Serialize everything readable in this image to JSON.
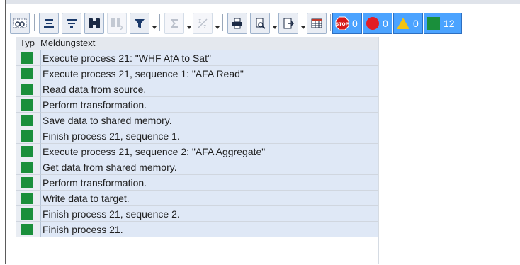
{
  "toolbar": {
    "icons": [
      "details-icon",
      "sort-ascending-icon",
      "filter-lines-icon",
      "find-icon",
      "find-next-icon",
      "set-filter-icon",
      "total-icon",
      "subtotal-icon",
      "print-icon",
      "print-preview-icon",
      "export-icon",
      "layout-grid-icon"
    ],
    "counters": [
      {
        "name": "stop-counter",
        "label": "0",
        "icon": "stop-icon"
      },
      {
        "name": "error-counter",
        "label": "0",
        "icon": "red-circle-icon"
      },
      {
        "name": "warning-counter",
        "label": "0",
        "icon": "warning-triangle-icon"
      },
      {
        "name": "success-counter",
        "label": "12",
        "icon": "green-square-icon"
      }
    ],
    "colors": {
      "counter_bg": "#4ba3ff",
      "stop": "#d71a1a",
      "error": "#e31e24",
      "warning": "#f3c311",
      "success": "#1a8f3b"
    }
  },
  "table": {
    "col_type": "Typ",
    "col_message": "Meldungstext",
    "rows": [
      {
        "text": "Execute process 21: \"WHF AfA to Sat\""
      },
      {
        "text": "Execute process 21, sequence 1: \"AFA Read\""
      },
      {
        "text": "Read data from source."
      },
      {
        "text": "Perform transformation."
      },
      {
        "text": "Save data to shared memory."
      },
      {
        "text": "Finish process 21, sequence 1."
      },
      {
        "text": "Execute process 21, sequence 2: \"AFA Aggregate\""
      },
      {
        "text": "Get data from shared memory."
      },
      {
        "text": "Perform transformation."
      },
      {
        "text": "Write data to target."
      },
      {
        "text": "Finish process 21, sequence 2."
      },
      {
        "text": "Finish process 21."
      }
    ]
  }
}
